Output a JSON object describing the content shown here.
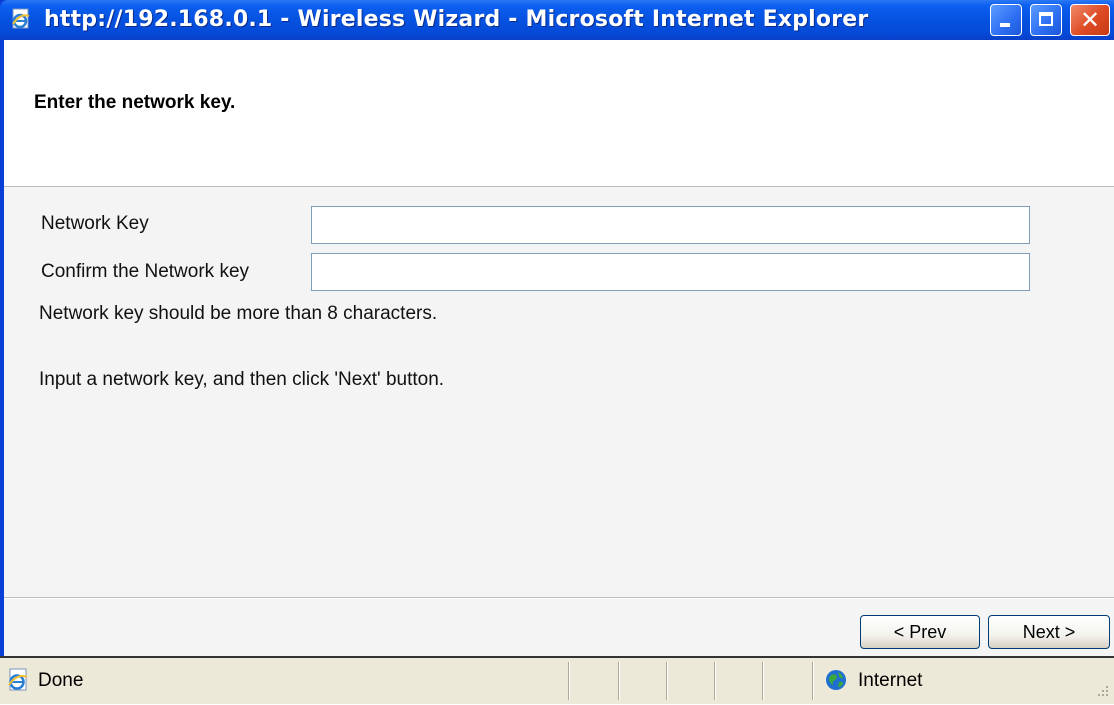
{
  "window": {
    "title": "http://192.168.0.1 - Wireless Wizard - Microsoft Internet Explorer",
    "icons": {
      "app": "ie-page-icon",
      "minimize": "minimize-icon",
      "maximize": "maximize-icon",
      "close": "close-icon"
    },
    "close_glyph": "✕"
  },
  "wizard": {
    "heading": "Enter the network key.",
    "fields": {
      "network_key": {
        "label": "Network Key",
        "value": "",
        "placeholder": ""
      },
      "confirm_key": {
        "label": "Confirm the Network key",
        "value": "",
        "placeholder": ""
      }
    },
    "hint": "Network key should be more than 8 characters.",
    "instruction": "Input a network key, and then click 'Next' button.",
    "buttons": {
      "prev": "< Prev",
      "next": "Next >"
    }
  },
  "statusbar": {
    "status": "Done",
    "zone": "Internet",
    "icons": {
      "status": "ie-page-icon",
      "zone": "globe-icon",
      "grip": "resize-grip-icon"
    }
  },
  "colors": {
    "titlebar": "#0652e0",
    "frame": "#0a3fd6",
    "close_button": "#de4b24",
    "statusbar": "#ece9d8",
    "button_border": "#003c74",
    "field_border": "#7f9db9"
  }
}
